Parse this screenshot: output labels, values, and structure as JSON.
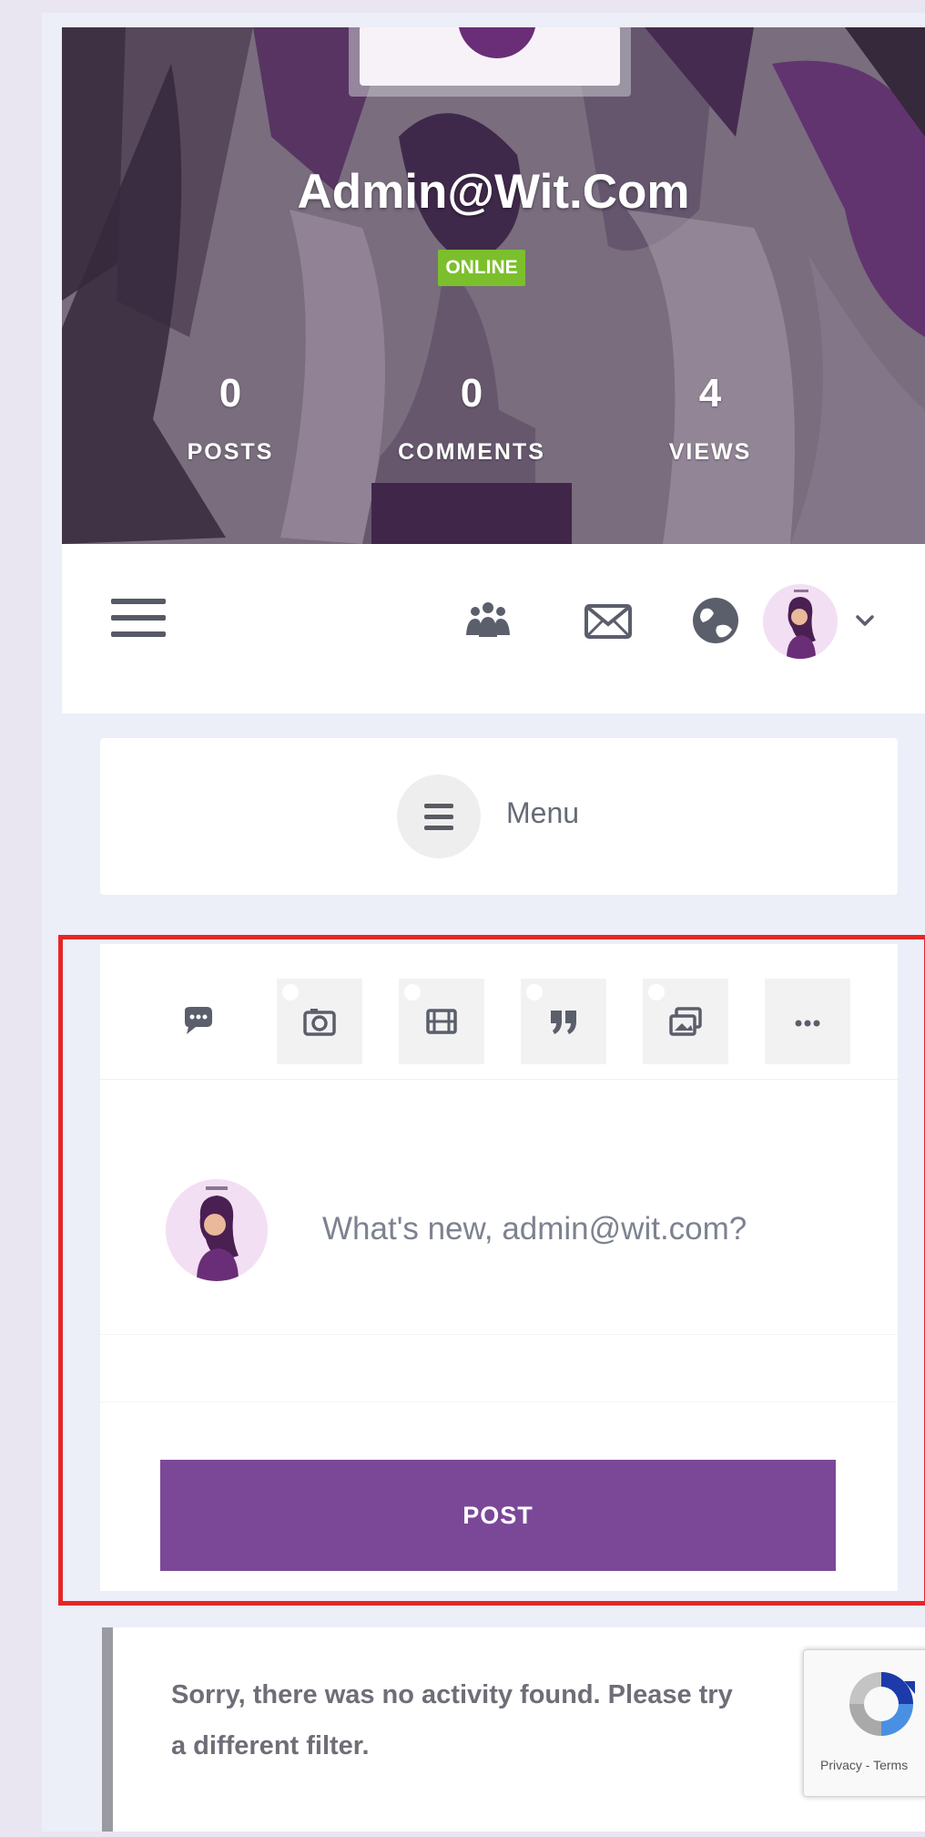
{
  "profile": {
    "name": "Admin@Wit.Com",
    "status": "ONLINE",
    "stats": [
      {
        "value": "0",
        "label": "POSTS"
      },
      {
        "value": "0",
        "label": "COMMENTS"
      },
      {
        "value": "4",
        "label": "VIEWS"
      }
    ]
  },
  "nav": {
    "icons": [
      "users-icon",
      "mail-icon",
      "globe-icon"
    ]
  },
  "menu": {
    "label": "Menu"
  },
  "composer": {
    "post_types": [
      "status-bubble-icon",
      "photo-icon",
      "video-icon",
      "quote-icon",
      "gallery-icon",
      "more-icon"
    ],
    "placeholder": "What's new, admin@wit.com?",
    "post_label": "POST"
  },
  "activity": {
    "empty_message": "Sorry, there was no activity found. Please try a different filter."
  },
  "recaptcha": {
    "footer": "Privacy - Terms"
  },
  "colors": {
    "accent": "#7b4898",
    "online": "#7cbf2c",
    "highlight": "#e52628"
  }
}
